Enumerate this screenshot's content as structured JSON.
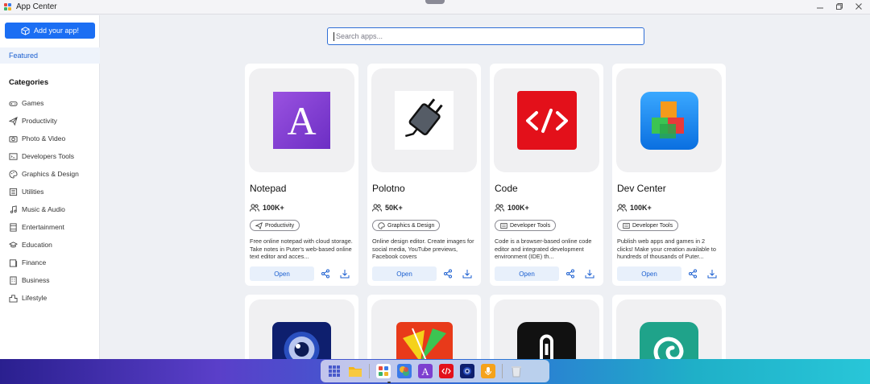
{
  "window": {
    "title": "App Center"
  },
  "sidebar": {
    "add_button": "Add your app!",
    "featured": "Featured",
    "categories_heading": "Categories",
    "categories": [
      {
        "label": "Games",
        "icon": "gamepad-icon"
      },
      {
        "label": "Productivity",
        "icon": "paper-plane-icon"
      },
      {
        "label": "Photo & Video",
        "icon": "camera-icon"
      },
      {
        "label": "Developers Tools",
        "icon": "terminal-icon"
      },
      {
        "label": "Graphics & Design",
        "icon": "palette-icon"
      },
      {
        "label": "Utilities",
        "icon": "list-icon"
      },
      {
        "label": "Music & Audio",
        "icon": "music-note-icon"
      },
      {
        "label": "Entertainment",
        "icon": "film-icon"
      },
      {
        "label": "Education",
        "icon": "graduation-cap-icon"
      },
      {
        "label": "Finance",
        "icon": "wallet-icon"
      },
      {
        "label": "Business",
        "icon": "building-icon"
      },
      {
        "label": "Lifestyle",
        "icon": "city-icon"
      }
    ]
  },
  "search": {
    "placeholder": "Search apps..."
  },
  "apps": [
    {
      "name": "Notepad",
      "users": "100K+",
      "category": "Productivity",
      "description": "Free online notepad with cloud storage. Take notes in Puter's web-based online text editor and acces...",
      "open_label": "Open",
      "accent": "#8b3fd6"
    },
    {
      "name": "Polotno",
      "users": "50K+",
      "category": "Graphics & Design",
      "description": "Online design editor. Create images for social media, YouTube previews, Facebook covers",
      "open_label": "Open",
      "accent": "#222222"
    },
    {
      "name": "Code",
      "users": "100K+",
      "category": "Developer Tools",
      "description": "Code is a browser-based online code editor and integrated development environment (IDE) th...",
      "open_label": "Open",
      "accent": "#e3101a"
    },
    {
      "name": "Dev Center",
      "users": "100K+",
      "category": "Developer Tools",
      "description": "Publish web apps and games in 2 clicks! Make your creation available to hundreds of thousands of Puter...",
      "open_label": "Open",
      "accent": "#1e8cf0"
    }
  ],
  "colors": {
    "primary": "#1b6ef3",
    "open_bg": "#e8f0fb"
  }
}
